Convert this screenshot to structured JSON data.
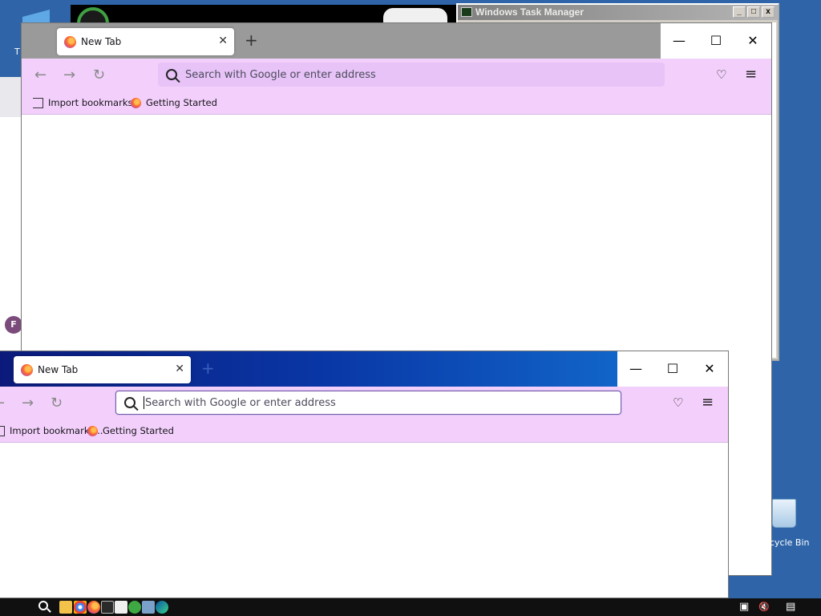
{
  "desktop": {
    "icon_top_label": "T",
    "recycle_bin_label": "cycle Bin"
  },
  "task_manager": {
    "title": "Windows Task Manager",
    "min_label": "_",
    "max_label": "□",
    "close_label": "x"
  },
  "left_window": {
    "avatar_letter": "F"
  },
  "window_a": {
    "tab_title": "New Tab",
    "tab_close": "✕",
    "new_tab": "+",
    "minimize": "—",
    "maximize": "☐",
    "close": "✕",
    "back": "←",
    "forward": "→",
    "reload": "↻",
    "search_placeholder": "Search with Google or enter address",
    "pocket": "♡",
    "menu": "≡",
    "bookmarks": [
      {
        "label": "Import bookmarks...",
        "icon": "import-icon"
      },
      {
        "label": "Getting Started",
        "icon": "firefox-icon"
      }
    ]
  },
  "window_b": {
    "tab_title": "New Tab",
    "tab_close": "✕",
    "new_tab": "+",
    "minimize": "—",
    "maximize": "☐",
    "close": "✕",
    "back": "←",
    "forward": "→",
    "reload": "↻",
    "search_placeholder": "Search with Google or enter address",
    "pocket": "♡",
    "menu": "≡",
    "bookmarks": [
      {
        "label": "Import bookmarks...",
        "icon": "import-icon"
      },
      {
        "label": "Getting Started",
        "icon": "firefox-icon"
      }
    ]
  },
  "taskbar": {
    "tray_network": "▣",
    "tray_volume": "🔇",
    "tray_notifications": "▤"
  },
  "colors": {
    "toolbar": "#f3d0fb",
    "urlbar": "#e7c3f7",
    "desktop": "#2f65a8"
  }
}
